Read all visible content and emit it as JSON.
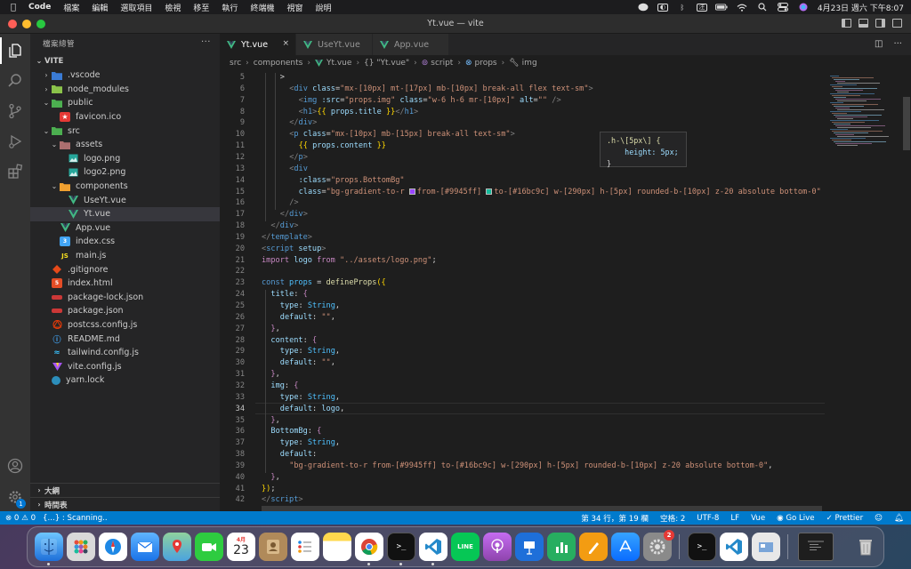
{
  "menubar": {
    "app_name": "Code",
    "items": [
      "檔案",
      "編輯",
      "選取項目",
      "檢視",
      "移至",
      "執行",
      "終端機",
      "視窗",
      "說明"
    ],
    "clock": "4月23日 週六 下午8:07",
    "battery": "100",
    "status_icons": [
      "line-icon",
      "bluetooth-icon",
      "input-method-icon",
      "battery-icon",
      "wifi-icon",
      "spotlight-icon",
      "control-center-icon",
      "siri-icon"
    ]
  },
  "window": {
    "title": "Yt.vue — vite"
  },
  "sidebar": {
    "header": "檔案總管",
    "root": "VITE",
    "rows": [
      {
        "label": ".vscode",
        "depth": 1,
        "chev": "›",
        "icon": "folder-icon",
        "color": "#3a7bd5"
      },
      {
        "label": "node_modules",
        "depth": 1,
        "chev": "›",
        "icon": "folder-icon",
        "color": "#8bc34a"
      },
      {
        "label": "public",
        "depth": 1,
        "chev": "⌄",
        "icon": "folder-icon",
        "color": "#4caf50"
      },
      {
        "label": "favicon.ico",
        "depth": 2,
        "chev": "",
        "icon": "star-icon",
        "color": "#e53935"
      },
      {
        "label": "src",
        "depth": 1,
        "chev": "⌄",
        "icon": "folder-icon",
        "color": "#4caf50"
      },
      {
        "label": "assets",
        "depth": 2,
        "chev": "⌄",
        "icon": "folder-icon",
        "color": "#ab6f6f"
      },
      {
        "label": "logo.png",
        "depth": 3,
        "chev": "",
        "icon": "image-icon",
        "color": "#26a69a"
      },
      {
        "label": "logo2.png",
        "depth": 3,
        "chev": "",
        "icon": "image-icon",
        "color": "#26a69a"
      },
      {
        "label": "components",
        "depth": 2,
        "chev": "⌄",
        "icon": "folder-icon",
        "color": "#f0a030"
      },
      {
        "label": "UseYt.vue",
        "depth": 3,
        "chev": "",
        "icon": "vue-icon",
        "color": "#41b883"
      },
      {
        "label": "Yt.vue",
        "depth": 3,
        "chev": "",
        "icon": "vue-icon",
        "color": "#41b883",
        "selected": true
      },
      {
        "label": "App.vue",
        "depth": 2,
        "chev": "",
        "icon": "vue-icon",
        "color": "#41b883"
      },
      {
        "label": "index.css",
        "depth": 2,
        "chev": "",
        "icon": "css-icon",
        "color": "#42a5f5"
      },
      {
        "label": "main.js",
        "depth": 2,
        "chev": "",
        "icon": "js-icon",
        "color": "#f7df1e"
      },
      {
        "label": ".gitignore",
        "depth": 1,
        "chev": "",
        "icon": "git-icon",
        "color": "#e64a19"
      },
      {
        "label": "index.html",
        "depth": 1,
        "chev": "",
        "icon": "html-icon",
        "color": "#e44d26"
      },
      {
        "label": "package-lock.json",
        "depth": 1,
        "chev": "",
        "icon": "npm-icon",
        "color": "#cb3837"
      },
      {
        "label": "package.json",
        "depth": 1,
        "chev": "",
        "icon": "npm-icon",
        "color": "#cb3837"
      },
      {
        "label": "postcss.config.js",
        "depth": 1,
        "chev": "",
        "icon": "postcss-icon",
        "color": "#dd3a0a"
      },
      {
        "label": "README.md",
        "depth": 1,
        "chev": "",
        "icon": "info-icon",
        "color": "#42a5f5"
      },
      {
        "label": "tailwind.config.js",
        "depth": 1,
        "chev": "",
        "icon": "tailwind-icon",
        "color": "#38bdf8"
      },
      {
        "label": "vite.config.js",
        "depth": 1,
        "chev": "",
        "icon": "vite-icon",
        "color": "#a855f7"
      },
      {
        "label": "yarn.lock",
        "depth": 1,
        "chev": "",
        "icon": "yarn-icon",
        "color": "#2c8ebb"
      }
    ],
    "outline": "大綱",
    "timeline": "時間表"
  },
  "tabs": [
    {
      "label": "Yt.vue",
      "active": true,
      "close": "×"
    },
    {
      "label": "UseYt.vue",
      "active": false
    },
    {
      "label": "App.vue",
      "active": false
    }
  ],
  "breadcrumb": [
    "src",
    "components",
    "Yt.vue",
    "{} \"Yt.vue\"",
    "script",
    "props",
    "img"
  ],
  "hover": {
    "line1": ".h-\\[5px\\] {",
    "line2": "    height: 5px;",
    "line3": "}"
  },
  "editor": {
    "cursor_line": 34,
    "lines": [
      {
        "n": 5,
        "indent": 2,
        "tokens": [
          {
            "c": "p",
            "t": ">"
          }
        ]
      },
      {
        "n": 6,
        "indent": 3,
        "tokens": [
          {
            "c": "g",
            "t": "<"
          },
          {
            "c": "t",
            "t": "div"
          },
          {
            "c": "a",
            "t": " class"
          },
          {
            "c": "p",
            "t": "="
          },
          {
            "c": "s",
            "t": "\"mx-[10px] mt-[17px] mb-[10px] break-all flex text-sm\""
          },
          {
            "c": "g",
            "t": ">"
          }
        ]
      },
      {
        "n": 7,
        "indent": 4,
        "tokens": [
          {
            "c": "g",
            "t": "<"
          },
          {
            "c": "t",
            "t": "img"
          },
          {
            "c": "a",
            "t": " :src"
          },
          {
            "c": "p",
            "t": "="
          },
          {
            "c": "s",
            "t": "\"props.img\""
          },
          {
            "c": "a",
            "t": " class"
          },
          {
            "c": "p",
            "t": "="
          },
          {
            "c": "s",
            "t": "\"w-6 h-6 mr-[10px]\""
          },
          {
            "c": "a",
            "t": " alt"
          },
          {
            "c": "p",
            "t": "="
          },
          {
            "c": "s",
            "t": "\"\""
          },
          {
            "c": "g",
            "t": " />"
          }
        ]
      },
      {
        "n": 8,
        "indent": 4,
        "tokens": [
          {
            "c": "g",
            "t": "<"
          },
          {
            "c": "t",
            "t": "h1"
          },
          {
            "c": "g",
            "t": ">"
          },
          {
            "c": "y",
            "t": "{{"
          },
          {
            "c": "a",
            "t": " props.title "
          },
          {
            "c": "y",
            "t": "}}"
          },
          {
            "c": "g",
            "t": "</"
          },
          {
            "c": "t",
            "t": "h1"
          },
          {
            "c": "g",
            "t": ">"
          }
        ]
      },
      {
        "n": 9,
        "indent": 3,
        "tokens": [
          {
            "c": "g",
            "t": "</"
          },
          {
            "c": "t",
            "t": "div"
          },
          {
            "c": "g",
            "t": ">"
          }
        ]
      },
      {
        "n": 10,
        "indent": 3,
        "tokens": [
          {
            "c": "g",
            "t": "<"
          },
          {
            "c": "t",
            "t": "p"
          },
          {
            "c": "a",
            "t": " class"
          },
          {
            "c": "p",
            "t": "="
          },
          {
            "c": "s",
            "t": "\"mx-[10px] mb-[15px] break-all text-sm\""
          },
          {
            "c": "g",
            "t": ">"
          }
        ]
      },
      {
        "n": 11,
        "indent": 4,
        "tokens": [
          {
            "c": "y",
            "t": "{{"
          },
          {
            "c": "a",
            "t": " props.content "
          },
          {
            "c": "y",
            "t": "}}"
          }
        ]
      },
      {
        "n": 12,
        "indent": 3,
        "tokens": [
          {
            "c": "g",
            "t": "</"
          },
          {
            "c": "t",
            "t": "p"
          },
          {
            "c": "g",
            "t": ">"
          }
        ]
      },
      {
        "n": 13,
        "indent": 3,
        "tokens": [
          {
            "c": "g",
            "t": "<"
          },
          {
            "c": "t",
            "t": "div"
          }
        ]
      },
      {
        "n": 14,
        "indent": 4,
        "tokens": [
          {
            "c": "a",
            "t": ":class"
          },
          {
            "c": "p",
            "t": "="
          },
          {
            "c": "s",
            "t": "\"props.BottomBg\""
          }
        ]
      },
      {
        "n": 15,
        "indent": 4,
        "tokens": [
          {
            "c": "a",
            "t": "class"
          },
          {
            "c": "p",
            "t": "="
          },
          {
            "c": "s",
            "t": "\"bg-gradient-to-r "
          },
          {
            "c": "sw",
            "t": "#9945ff"
          },
          {
            "c": "s",
            "t": "from-[#9945ff] "
          },
          {
            "c": "sw",
            "t": "#16bc9c"
          },
          {
            "c": "s",
            "t": "to-[#16bc9c] w-[290px] h-[5px] rounded-b-[10px] z-20 absolute bottom-0\""
          }
        ]
      },
      {
        "n": 16,
        "indent": 3,
        "tokens": [
          {
            "c": "g",
            "t": "/>"
          }
        ]
      },
      {
        "n": 17,
        "indent": 2,
        "tokens": [
          {
            "c": "g",
            "t": "</"
          },
          {
            "c": "t",
            "t": "div"
          },
          {
            "c": "g",
            "t": ">"
          }
        ]
      },
      {
        "n": 18,
        "indent": 1,
        "tokens": [
          {
            "c": "g",
            "t": "</"
          },
          {
            "c": "t",
            "t": "div"
          },
          {
            "c": "g",
            "t": ">"
          }
        ]
      },
      {
        "n": 19,
        "indent": 0,
        "tokens": [
          {
            "c": "g",
            "t": "</"
          },
          {
            "c": "t",
            "t": "template"
          },
          {
            "c": "g",
            "t": ">"
          }
        ]
      },
      {
        "n": 20,
        "indent": 0,
        "tokens": [
          {
            "c": "g",
            "t": "<"
          },
          {
            "c": "t",
            "t": "script"
          },
          {
            "c": "a",
            "t": " setup"
          },
          {
            "c": "g",
            "t": ">"
          }
        ]
      },
      {
        "n": 21,
        "indent": 0,
        "tokens": [
          {
            "c": "k",
            "t": "import"
          },
          {
            "c": "a",
            "t": " logo "
          },
          {
            "c": "k",
            "t": "from"
          },
          {
            "c": "s",
            "t": " \"../assets/logo.png\""
          },
          {
            "c": "p",
            "t": ";"
          }
        ]
      },
      {
        "n": 22,
        "indent": 0,
        "tokens": []
      },
      {
        "n": 23,
        "indent": 0,
        "tokens": [
          {
            "c": "t",
            "t": "const"
          },
          {
            "c": "v",
            "t": " props"
          },
          {
            "c": "p",
            "t": " = "
          },
          {
            "c": "f",
            "t": "defineProps"
          },
          {
            "c": "y",
            "t": "({"
          }
        ]
      },
      {
        "n": 24,
        "indent": 1,
        "tokens": [
          {
            "c": "a",
            "t": "title"
          },
          {
            "c": "p",
            "t": ": "
          },
          {
            "c": "k",
            "t": "{"
          }
        ]
      },
      {
        "n": 25,
        "indent": 2,
        "tokens": [
          {
            "c": "a",
            "t": "type"
          },
          {
            "c": "p",
            "t": ": "
          },
          {
            "c": "v",
            "t": "String"
          },
          {
            "c": "p",
            "t": ","
          }
        ]
      },
      {
        "n": 26,
        "indent": 2,
        "tokens": [
          {
            "c": "a",
            "t": "default"
          },
          {
            "c": "p",
            "t": ": "
          },
          {
            "c": "s",
            "t": "\"\""
          },
          {
            "c": "p",
            "t": ","
          }
        ]
      },
      {
        "n": 27,
        "indent": 1,
        "tokens": [
          {
            "c": "k",
            "t": "}"
          },
          {
            "c": "p",
            "t": ","
          }
        ]
      },
      {
        "n": 28,
        "indent": 1,
        "tokens": [
          {
            "c": "a",
            "t": "content"
          },
          {
            "c": "p",
            "t": ": "
          },
          {
            "c": "k",
            "t": "{"
          }
        ]
      },
      {
        "n": 29,
        "indent": 2,
        "tokens": [
          {
            "c": "a",
            "t": "type"
          },
          {
            "c": "p",
            "t": ": "
          },
          {
            "c": "v",
            "t": "String"
          },
          {
            "c": "p",
            "t": ","
          }
        ]
      },
      {
        "n": 30,
        "indent": 2,
        "tokens": [
          {
            "c": "a",
            "t": "default"
          },
          {
            "c": "p",
            "t": ": "
          },
          {
            "c": "s",
            "t": "\"\""
          },
          {
            "c": "p",
            "t": ","
          }
        ]
      },
      {
        "n": 31,
        "indent": 1,
        "tokens": [
          {
            "c": "k",
            "t": "}"
          },
          {
            "c": "p",
            "t": ","
          }
        ]
      },
      {
        "n": 32,
        "indent": 1,
        "tokens": [
          {
            "c": "a",
            "t": "img"
          },
          {
            "c": "p",
            "t": ": "
          },
          {
            "c": "k",
            "t": "{"
          }
        ]
      },
      {
        "n": 33,
        "indent": 2,
        "tokens": [
          {
            "c": "a",
            "t": "type"
          },
          {
            "c": "p",
            "t": ": "
          },
          {
            "c": "v",
            "t": "String"
          },
          {
            "c": "p",
            "t": ","
          }
        ]
      },
      {
        "n": 34,
        "indent": 2,
        "tokens": [
          {
            "c": "a",
            "t": "default"
          },
          {
            "c": "p",
            "t": ": "
          },
          {
            "c": "a",
            "t": "logo"
          },
          {
            "c": "p",
            "t": ","
          }
        ]
      },
      {
        "n": 35,
        "indent": 1,
        "tokens": [
          {
            "c": "k",
            "t": "}"
          },
          {
            "c": "p",
            "t": ","
          }
        ]
      },
      {
        "n": 36,
        "indent": 1,
        "tokens": [
          {
            "c": "a",
            "t": "BottomBg"
          },
          {
            "c": "p",
            "t": ": "
          },
          {
            "c": "k",
            "t": "{"
          }
        ]
      },
      {
        "n": 37,
        "indent": 2,
        "tokens": [
          {
            "c": "a",
            "t": "type"
          },
          {
            "c": "p",
            "t": ": "
          },
          {
            "c": "v",
            "t": "String"
          },
          {
            "c": "p",
            "t": ","
          }
        ]
      },
      {
        "n": 38,
        "indent": 2,
        "tokens": [
          {
            "c": "a",
            "t": "default"
          },
          {
            "c": "p",
            "t": ":"
          }
        ]
      },
      {
        "n": 39,
        "indent": 3,
        "tokens": [
          {
            "c": "s",
            "t": "\"bg-gradient-to-r from-[#9945ff] to-[#16bc9c] w-[290px] h-[5px] rounded-b-[10px] z-20 absolute bottom-0\""
          },
          {
            "c": "p",
            "t": ","
          }
        ]
      },
      {
        "n": 40,
        "indent": 1,
        "tokens": [
          {
            "c": "k",
            "t": "}"
          },
          {
            "c": "p",
            "t": ","
          }
        ]
      },
      {
        "n": 41,
        "indent": 0,
        "tokens": [
          {
            "c": "y",
            "t": "})"
          },
          {
            "c": "p",
            "t": ";"
          }
        ]
      },
      {
        "n": 42,
        "indent": 0,
        "tokens": [
          {
            "c": "g",
            "t": "</"
          },
          {
            "c": "t",
            "t": "script"
          },
          {
            "c": "g",
            "t": ">"
          }
        ]
      }
    ]
  },
  "statusbar": {
    "errors": "⊗ 0 ⚠ 0",
    "scanning": "{...} : Scanning..",
    "position": "第 34 行，第 19 欄",
    "spaces": "空格: 2",
    "encoding": "UTF-8",
    "eol": "LF",
    "language": "Vue",
    "golive": "◉ Go Live",
    "prettier": "✓ Prettier"
  },
  "dock": {
    "calendar_month": "4月",
    "calendar_day": "23",
    "settings_badge": "2",
    "apps": [
      "finder-icon",
      "launchpad-icon",
      "safari-icon",
      "mail-icon",
      "maps-icon",
      "facetime-icon",
      "calendar-icon",
      "contacts-icon",
      "reminders-icon",
      "notes-icon",
      "chrome-icon",
      "terminal-icon",
      "vscode-icon",
      "line-icon",
      "podcasts-icon",
      "keynote-icon",
      "numbers-icon",
      "pages-icon",
      "appstore-icon",
      "system-preferences-icon",
      "terminal-icon",
      "vscode-icon",
      "preview-icon",
      "window-thumb-icon",
      "trash-icon"
    ]
  }
}
